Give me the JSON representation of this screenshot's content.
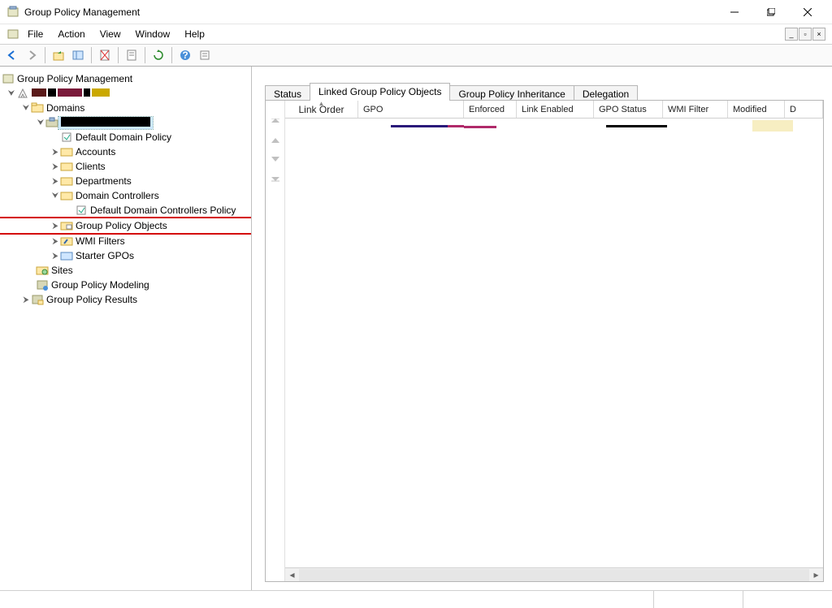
{
  "window": {
    "title": "Group Policy Management"
  },
  "menu": {
    "file": "File",
    "action": "Action",
    "view": "View",
    "window": "Window",
    "help": "Help"
  },
  "tree": {
    "root": "Group Policy Management",
    "forest_redacted": true,
    "domains": "Domains",
    "domain_redacted": true,
    "default_domain_policy": "Default Domain Policy",
    "accounts": "Accounts",
    "clients": "Clients",
    "departments": "Departments",
    "domain_controllers": "Domain Controllers",
    "default_dc_policy": "Default Domain Controllers Policy",
    "gpo": "Group Policy Objects",
    "wmi": "WMI Filters",
    "starter": "Starter GPOs",
    "sites": "Sites",
    "modeling": "Group Policy Modeling",
    "results": "Group Policy Results"
  },
  "tabs": {
    "status": "Status",
    "linked": "Linked Group Policy Objects",
    "inherit": "Group Policy Inheritance",
    "delegation": "Delegation"
  },
  "columns": {
    "link_order": "Link Order",
    "gpo": "GPO",
    "enforced": "Enforced",
    "link_enabled": "Link Enabled",
    "gpo_status": "GPO Status",
    "wmi_filter": "WMI Filter",
    "modified": "Modified",
    "d": "D"
  }
}
